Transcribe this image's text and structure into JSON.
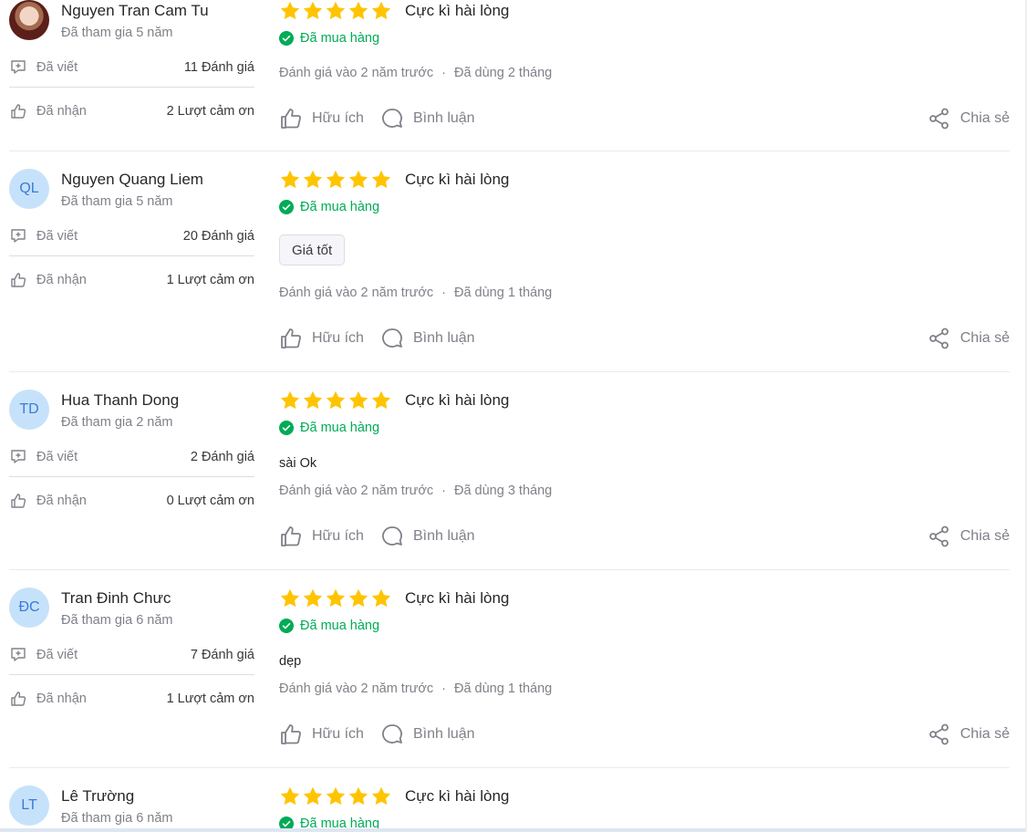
{
  "reviews": [
    {
      "author": {
        "name": "Nguyen Tran Cam Tu",
        "initials": "",
        "avatar_type": "photo",
        "joined": "Đã tham gia 5 năm",
        "written_label": "Đã viết",
        "written_value": "11 Đánh giá",
        "received_label": "Đã nhận",
        "received_value": "2 Lượt cảm ơn"
      },
      "rating": 5,
      "rating_label": "Cực kì hài lòng",
      "purchased_label": "Đã mua hàng",
      "tag": "",
      "text": "",
      "meta_date": "Đánh giá vào 2 năm trước",
      "meta_usage": "Đã dùng 2 tháng",
      "helpful_label": "Hữu ích",
      "comment_label": "Bình luận",
      "share_label": "Chia sẻ"
    },
    {
      "author": {
        "name": "Nguyen Quang Liem",
        "initials": "QL",
        "avatar_type": "initials",
        "joined": "Đã tham gia 5 năm",
        "written_label": "Đã viết",
        "written_value": "20 Đánh giá",
        "received_label": "Đã nhận",
        "received_value": "1 Lượt cảm ơn"
      },
      "rating": 5,
      "rating_label": "Cực kì hài lòng",
      "purchased_label": "Đã mua hàng",
      "tag": "Giá tốt",
      "text": "",
      "meta_date": "Đánh giá vào 2 năm trước",
      "meta_usage": "Đã dùng 1 tháng",
      "helpful_label": "Hữu ích",
      "comment_label": "Bình luận",
      "share_label": "Chia sẻ"
    },
    {
      "author": {
        "name": "Hua Thanh Dong",
        "initials": "TD",
        "avatar_type": "initials",
        "joined": "Đã tham gia 2 năm",
        "written_label": "Đã viết",
        "written_value": "2 Đánh giá",
        "received_label": "Đã nhận",
        "received_value": "0 Lượt cảm ơn"
      },
      "rating": 5,
      "rating_label": "Cực kì hài lòng",
      "purchased_label": "Đã mua hàng",
      "tag": "",
      "text": "sài Ok",
      "meta_date": "Đánh giá vào 2 năm trước",
      "meta_usage": "Đã dùng 3 tháng",
      "helpful_label": "Hữu ích",
      "comment_label": "Bình luận",
      "share_label": "Chia sẻ"
    },
    {
      "author": {
        "name": "Tran Đinh Chưc",
        "initials": "ĐC",
        "avatar_type": "initials",
        "joined": "Đã tham gia 6 năm",
        "written_label": "Đã viết",
        "written_value": "7 Đánh giá",
        "received_label": "Đã nhận",
        "received_value": "1 Lượt cảm ơn"
      },
      "rating": 5,
      "rating_label": "Cực kì hài lòng",
      "purchased_label": "Đã mua hàng",
      "tag": "",
      "text": "dẹp",
      "meta_date": "Đánh giá vào 2 năm trước",
      "meta_usage": "Đã dùng 1 tháng",
      "helpful_label": "Hữu ích",
      "comment_label": "Bình luận",
      "share_label": "Chia sẻ"
    },
    {
      "author": {
        "name": "Lê Trường",
        "initials": "LT",
        "avatar_type": "initials",
        "joined": "Đã tham gia 6 năm",
        "written_label": "",
        "written_value": "",
        "received_label": "",
        "received_value": ""
      },
      "rating": 5,
      "rating_label": "Cực kì hài lòng",
      "purchased_label": "Đã mua hàng",
      "tag": "",
      "text": "",
      "meta_date": "",
      "meta_usage": "",
      "helpful_label": "",
      "comment_label": "",
      "share_label": ""
    }
  ],
  "colors": {
    "star": "#ffc400",
    "purchased": "#00ab56",
    "avatar_bg": "#c6e2fb",
    "avatar_text": "#3a7bd5",
    "muted_text": "#808089"
  },
  "icons": {
    "written": "chat-bubble-plus-icon",
    "received": "thumbs-up-outline-icon",
    "helpful": "thumbs-up-icon",
    "comment": "comment-bubble-icon",
    "share": "share-nodes-icon",
    "purchased": "check-circle-icon",
    "star": "star-filled-icon"
  }
}
